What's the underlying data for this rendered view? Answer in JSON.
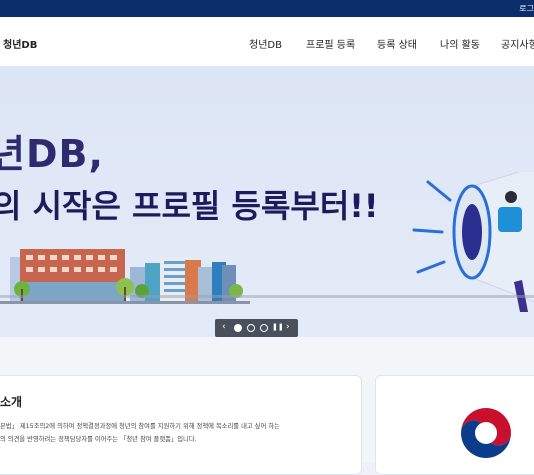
{
  "topbar": {
    "login_label": "로그"
  },
  "header": {
    "brand": "청년DB",
    "nav": [
      "청년DB",
      "프로필 등록",
      "등록 상태",
      "나의 활동",
      "공지사항"
    ]
  },
  "hero": {
    "title_line1": "년DB,",
    "title_line2": "의 시작은 프로필 등록부터!!"
  },
  "slider": {
    "prev": "‹",
    "next": "›",
    "pause": "❚❚",
    "active_index": 0,
    "count": 3
  },
  "intro": {
    "title": "소개",
    "line1": "본법」 제15조의2에 의하여 정책결정과정에 청년의 참여를 지원하기 위해 정책에 목소리를 내고 싶어 하는",
    "line2": "의 의견을 반영하려는 정책담당자를 이어주는 「청년 참여 플랫폼」입니다."
  },
  "colors": {
    "topbar": "#0c2d6b",
    "hero_title": "#2e2a6e",
    "accent_blue": "#1f6fd1"
  }
}
